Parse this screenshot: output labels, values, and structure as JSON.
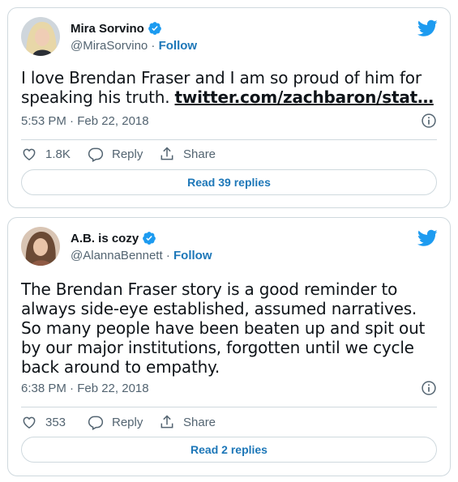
{
  "tweets": [
    {
      "name": "Mira Sorvino",
      "handle": "@MiraSorvino",
      "separator": " · ",
      "follow": "Follow",
      "text_plain": "I love Brendan Fraser and I am so proud of him for speaking his truth. ",
      "text_link": "twitter.com/zachbaron/stat…",
      "timestamp": "5:53 PM · Feb 22, 2018",
      "likes": "1.8K",
      "reply_label": "Reply",
      "share_label": "Share",
      "read_replies": "Read 39 replies"
    },
    {
      "name": "A.B. is cozy",
      "handle": "@AlannaBennett",
      "separator": " · ",
      "follow": "Follow",
      "text_plain": "The Brendan Fraser story is a good reminder to always side-eye established, assumed narratives. So many people have been beaten up and spit out by our major institutions, forgotten until we cycle back around to empathy.",
      "timestamp": "6:38 PM · Feb 22, 2018",
      "likes": "353",
      "reply_label": "Reply",
      "share_label": "Share",
      "read_replies": "Read 2 replies"
    }
  ],
  "colors": {
    "twitter_blue": "#1d9bf0",
    "link_blue": "#1d77b8",
    "secondary_text": "#536471",
    "border": "#cfd9de"
  },
  "icons": [
    "verified-badge-icon",
    "twitter-bird-icon",
    "info-icon",
    "heart-icon",
    "reply-bubble-icon",
    "share-icon"
  ]
}
